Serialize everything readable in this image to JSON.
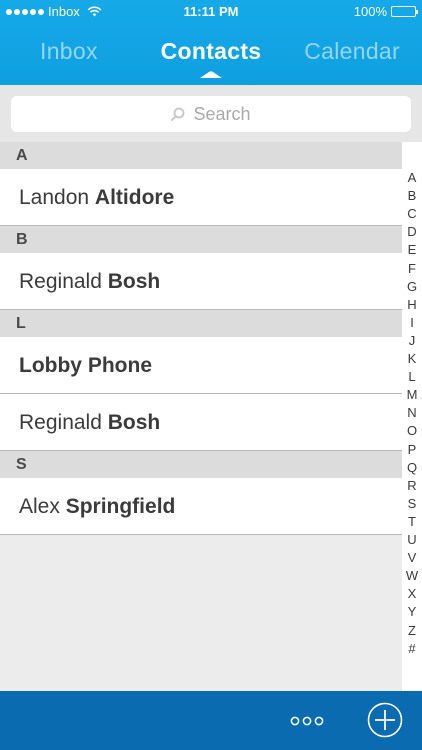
{
  "status_bar": {
    "carrier": "Inbox",
    "time": "11:11 PM",
    "battery_percent": "100%",
    "battery_level": 1.0
  },
  "tabs": [
    {
      "label": "Inbox",
      "active": false
    },
    {
      "label": "Contacts",
      "active": true
    },
    {
      "label": "Calendar",
      "active": false
    }
  ],
  "search": {
    "placeholder": "Search"
  },
  "sections": [
    {
      "letter": "A",
      "rows": [
        {
          "first": "Landon ",
          "last": "Altidore"
        }
      ]
    },
    {
      "letter": "B",
      "rows": [
        {
          "first": "Reginald ",
          "last": "Bosh"
        }
      ]
    },
    {
      "letter": "L",
      "rows": [
        {
          "full": "Lobby Phone"
        },
        {
          "first": "Reginald ",
          "last": "Bosh"
        }
      ]
    },
    {
      "letter": "S",
      "rows": [
        {
          "first": "Alex ",
          "last": "Springfield"
        }
      ]
    }
  ],
  "index_letters": [
    "A",
    "B",
    "C",
    "D",
    "E",
    "F",
    "G",
    "H",
    "I",
    "J",
    "K",
    "L",
    "M",
    "N",
    "O",
    "P",
    "Q",
    "R",
    "S",
    "T",
    "U",
    "V",
    "W",
    "X",
    "Y",
    "Z",
    "#"
  ],
  "colors": {
    "header_blue": "#16a9e8",
    "bottom_bar_blue": "#0b6bb0",
    "section_gray": "#dcdcdc"
  },
  "icons": {
    "more": "ellipsis-icon",
    "add": "plus-circle-icon",
    "search": "magnifier-icon"
  }
}
